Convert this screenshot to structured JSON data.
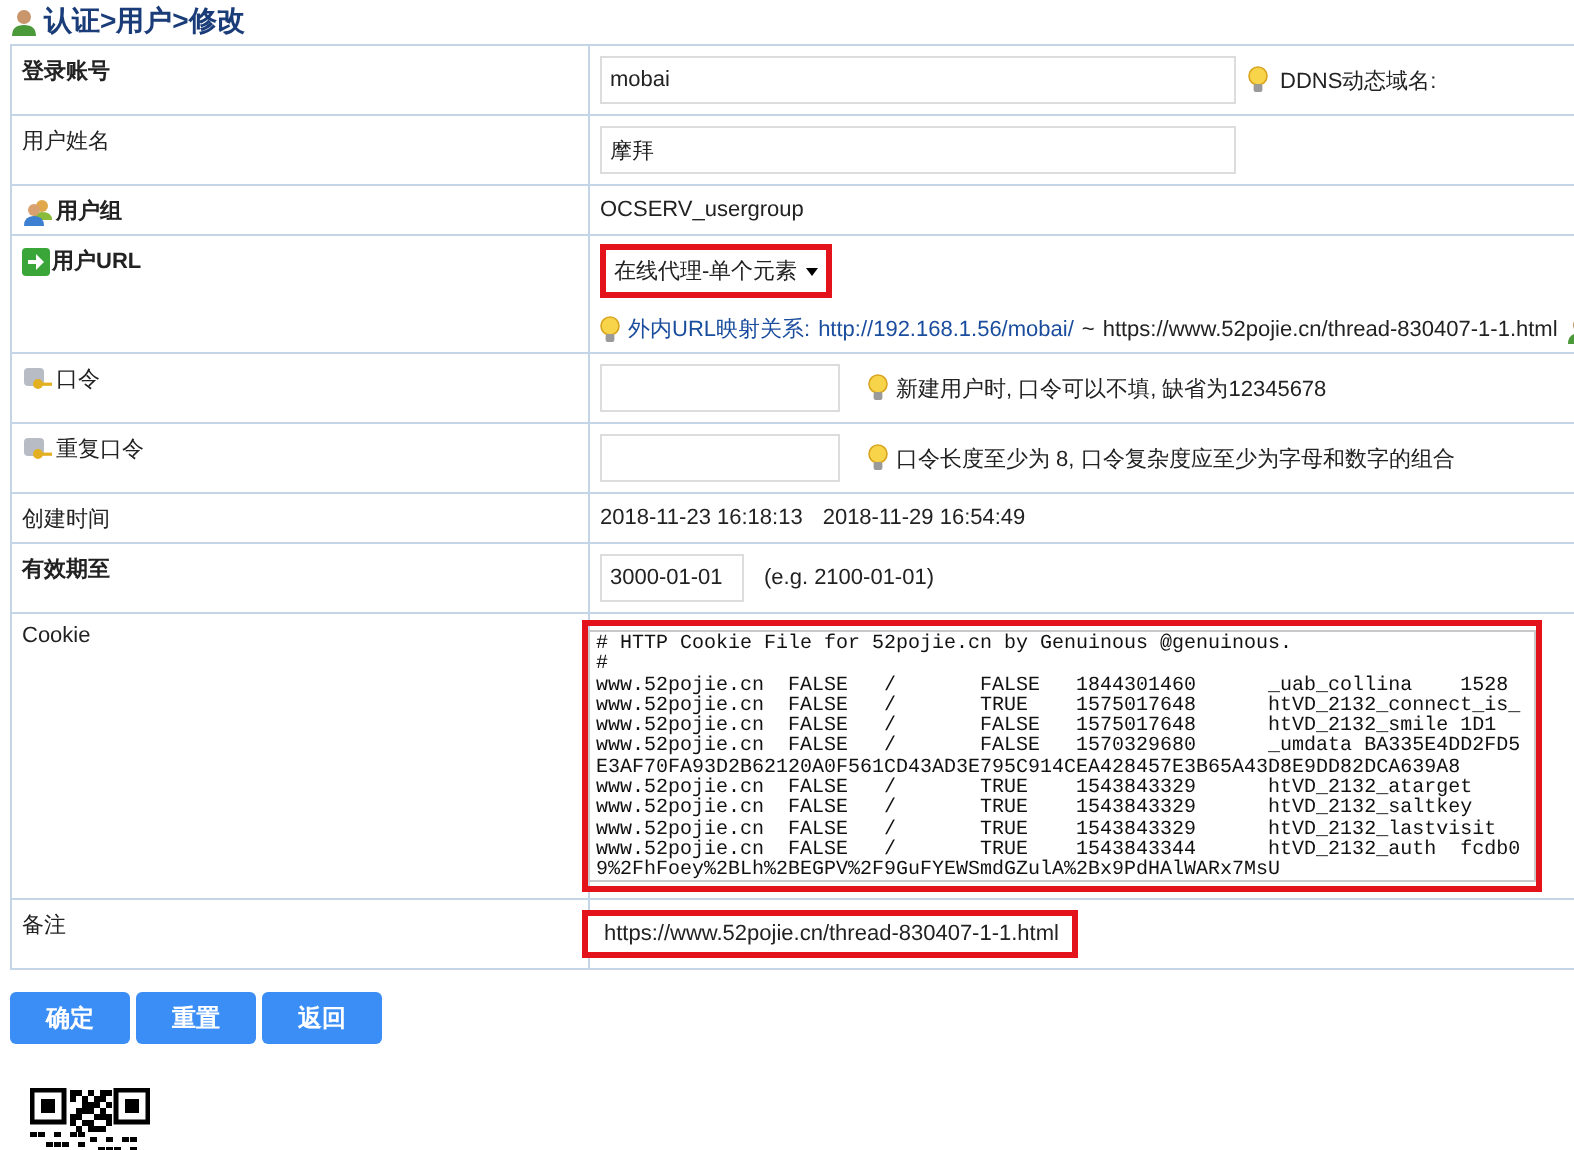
{
  "breadcrumb": "认证>用户>修改",
  "rows": [
    {
      "kind": "input",
      "label": "登录账号",
      "bold": true,
      "value": "mobai",
      "hint": "DDNS动态域名:"
    },
    {
      "kind": "input",
      "label": "用户姓名",
      "bold": false,
      "value": "摩拜"
    },
    {
      "kind": "text",
      "label": "用户组",
      "bold": true,
      "values": [
        "OCSERV_usergroup"
      ]
    },
    {
      "kind": "select",
      "label": "用户URL",
      "bold": true,
      "value": "在线代理-单个元素",
      "highlighted": true,
      "mapping": {
        "label": "外内URL映射关系:",
        "internal": "http://192.168.1.56/mobai/",
        "separator": "~",
        "external": "https://www.52pojie.cn/thread-830407-1-1.html"
      }
    },
    {
      "kind": "password",
      "label": "口令",
      "bold": false,
      "hint": "新建用户时, 口令可以不填, 缺省为12345678"
    },
    {
      "kind": "password",
      "label": "重复口令",
      "bold": false,
      "hint": "口令长度至少为 8, 口令复杂度应至少为字母和数字的组合"
    },
    {
      "kind": "text",
      "label": "创建时间",
      "bold": false,
      "values": [
        "2018-11-23 16:18:13",
        "2018-11-29 16:54:49"
      ]
    },
    {
      "kind": "date",
      "label": "有效期至",
      "bold": true,
      "value": "3000-01-01",
      "hint": "(e.g. 2100-01-01)"
    },
    {
      "kind": "textarea",
      "label": "Cookie",
      "bold": false,
      "highlighted": true,
      "lines": [
        "# HTTP Cookie File for 52pojie.cn by Genuinous @genuinous.",
        "#",
        "www.52pojie.cn  FALSE   /       FALSE   1844301460      _uab_collina    1528",
        "www.52pojie.cn  FALSE   /       TRUE    1575017648      htVD_2132_connect_is_",
        "www.52pojie.cn  FALSE   /       FALSE   1575017648      htVD_2132_smile 1D1",
        "www.52pojie.cn  FALSE   /       FALSE   1570329680      _umdata BA335E4DD2FD5",
        "E3AF70FA93D2B62120A0F561CD43AD3E795C914CEA428457E3B65A43D8E9DD82DCA639A8",
        "www.52pojie.cn  FALSE   /       TRUE    1543843329      htVD_2132_atarget",
        "www.52pojie.cn  FALSE   /       TRUE    1543843329      htVD_2132_saltkey",
        "www.52pojie.cn  FALSE   /       TRUE    1543843329      htVD_2132_lastvisit",
        "www.52pojie.cn  FALSE   /       TRUE    1543843344      htVD_2132_auth  fcdb0",
        "9%2FhFoey%2BLh%2BEGPV%2F9GuFYEWSmdGZulA%2Bx9PdHAlWARx7MsU"
      ]
    },
    {
      "kind": "note",
      "label": "备注",
      "bold": false,
      "value": "https://www.52pojie.cn/thread-830407-1-1.html",
      "highlighted": true
    }
  ],
  "buttons": [
    "确定",
    "重置",
    "返回"
  ]
}
